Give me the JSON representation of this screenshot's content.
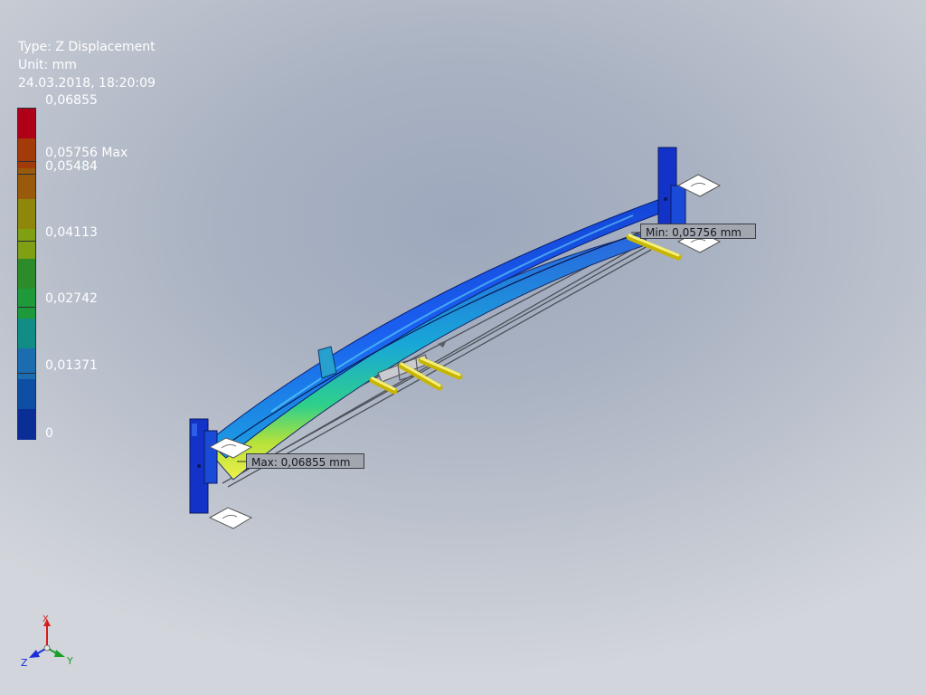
{
  "result_info": {
    "type_line": "Type: Z Displacement",
    "unit_line": "Unit: mm",
    "timestamp": "24.03.2018, 18:20:09"
  },
  "legend": {
    "labels": [
      "0,06855",
      "0,05756 Max",
      "0,05484",
      "0,04113",
      "0,02742",
      "0,01371",
      "0"
    ],
    "colors": [
      "#b00018",
      "#a33a0a",
      "#9a5a0c",
      "#8f870c",
      "#7fa012",
      "#2e8b2a",
      "#1f9a3b",
      "#128d86",
      "#1b6db0",
      "#0e4fa5",
      "#0a2e96"
    ]
  },
  "probes": {
    "max_label": "Max: 0,06855 mm",
    "min_label": "Min: 0,05756 mm"
  },
  "triad": {
    "z_label": "Z",
    "x_label": "X",
    "y_label": "Y"
  }
}
